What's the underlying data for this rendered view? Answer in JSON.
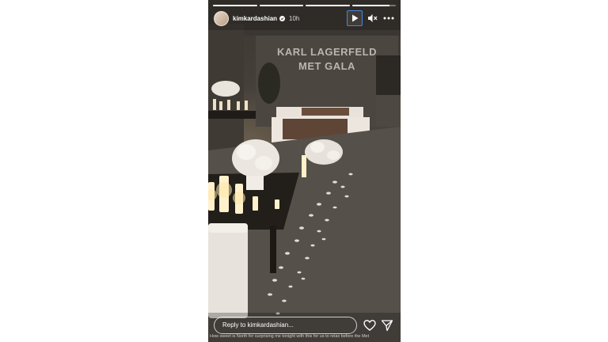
{
  "story": {
    "progress": {
      "segments": 4,
      "current_segment": 4,
      "current_fill": 0.85
    },
    "header": {
      "username": "kimkardashian",
      "verified": true,
      "time_ago": "10h",
      "icons": [
        "play-icon",
        "mute-icon",
        "more-icon"
      ]
    },
    "scene": {
      "balloon_text_line1": "KARL LAGERFELD",
      "balloon_text_line2": "MET GALA"
    },
    "footer": {
      "reply_placeholder": "Reply to kimkardashian...",
      "icons": [
        "heart-icon",
        "send-icon"
      ],
      "caption": "How sweet is North for surprising me tonight with this for us to relax before the Met"
    }
  }
}
